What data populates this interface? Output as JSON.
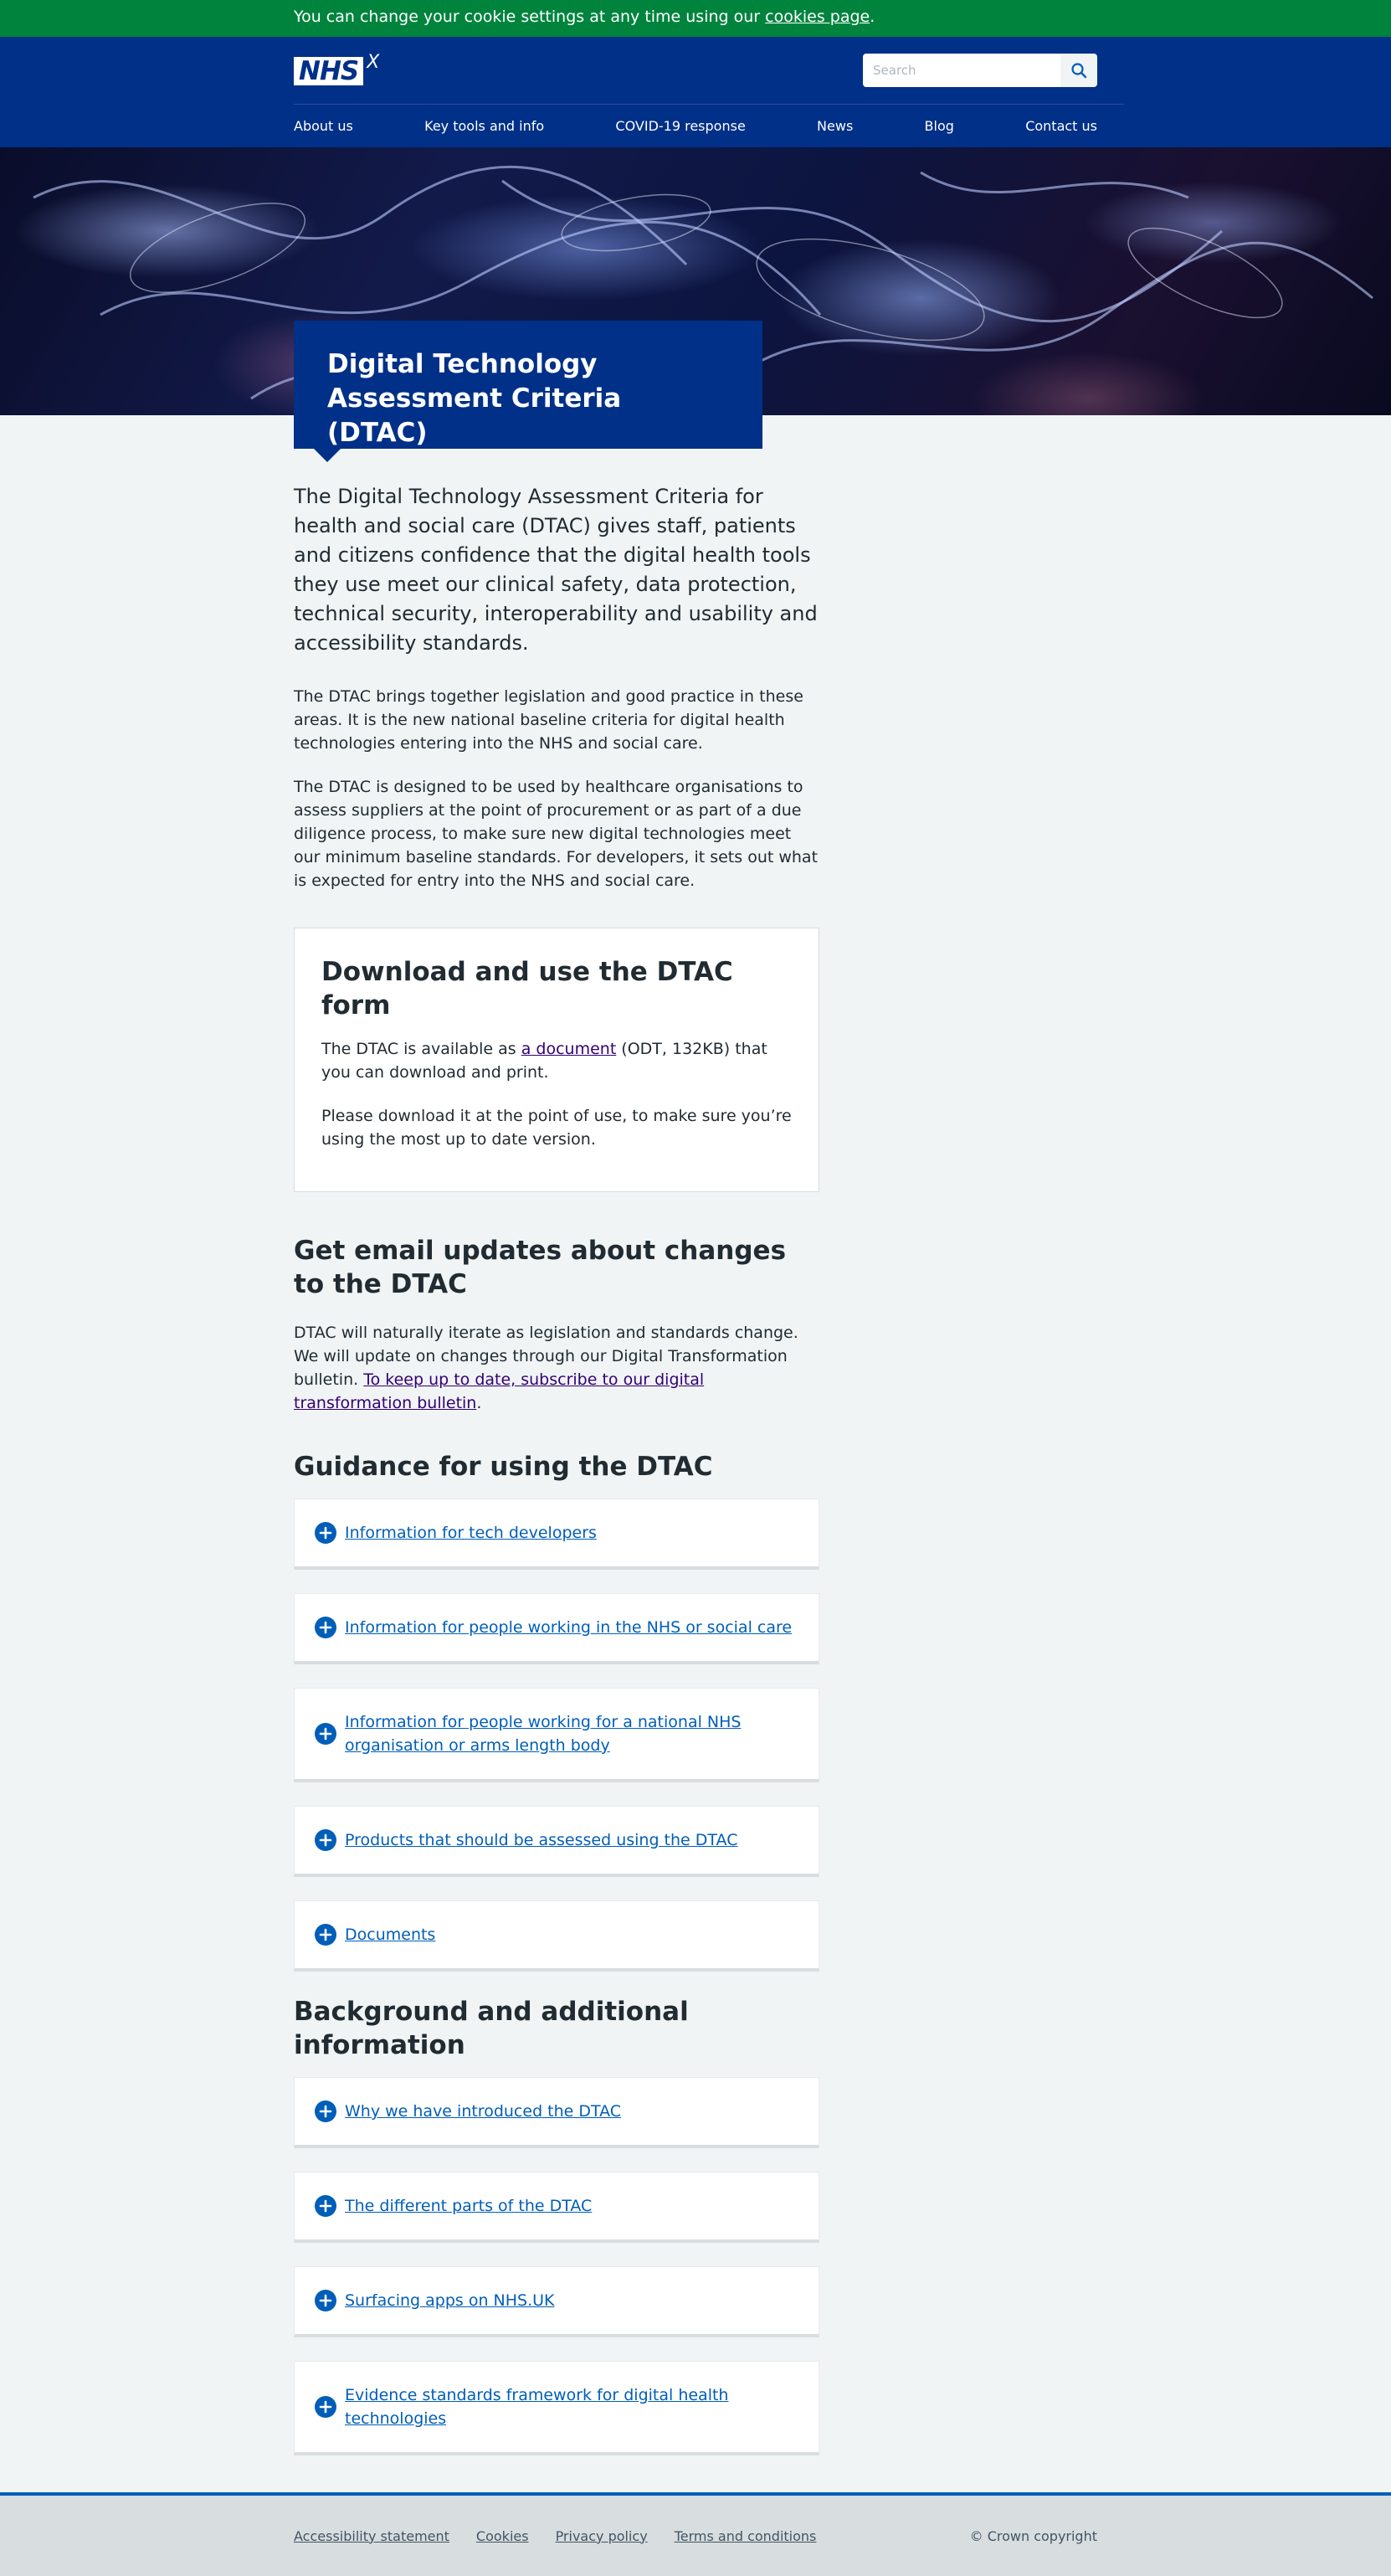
{
  "cookie_banner": {
    "text": "You can change your cookie settings at any time using our",
    "link": "cookies page",
    "suffix": "."
  },
  "header": {
    "logo_text": "NHS",
    "logo_suffix": "X",
    "search_placeholder": "Search",
    "nav": [
      "About us",
      "Key tools and info",
      "COVID-19 response",
      "News",
      "Blog",
      "Contact us"
    ]
  },
  "hero": {
    "title": "Digital Technology Assessment Criteria (DTAC)"
  },
  "intro": {
    "lede": "The Digital Technology Assessment Criteria for health and social care (DTAC) gives staff, patients and citizens confidence that the digital health tools they use meet our clinical safety, data protection, technical security, interoperability and usability and accessibility standards.",
    "para1": "The DTAC brings together legislation and good practice in these areas. It is the new national baseline criteria for digital health technologies entering into the NHS and social care.",
    "para2": "The DTAC is designed to be used by healthcare organisations to assess suppliers at the point of procurement or as part of a due diligence process, to make sure new digital technologies meet our minimum baseline standards. For developers, it sets out what is expected for entry into the NHS and social care."
  },
  "download": {
    "heading": "Download and use the DTAC form",
    "p1_before": "The DTAC is available as ",
    "p1_link": "a document",
    "p1_after": " (ODT, 132KB) that you can download and print.",
    "p2": "Please download it at the point of use, to make sure you’re using the most up to date version."
  },
  "email": {
    "heading": "Get email updates about changes to the DTAC",
    "text": "DTAC will naturally iterate as legislation and standards change. We will update on changes through our Digital Transformation bulletin.",
    "link": "To keep up to date, subscribe to our digital transformation bulletin",
    "suffix": "."
  },
  "guidance": {
    "heading": "Guidance for using the DTAC",
    "items": [
      "Information for tech developers",
      "Information for people working in the NHS or social care",
      "Information for people working for a national NHS organisation or arms length body",
      "Products that should be assessed using the DTAC",
      "Documents"
    ]
  },
  "background": {
    "heading": "Background and additional information",
    "items": [
      "Why we have introduced the DTAC",
      "The different parts of the DTAC",
      "Surfacing apps on NHS.UK",
      "Evidence standards framework for digital health technologies"
    ]
  },
  "footer": {
    "links": [
      "Accessibility statement",
      "Cookies",
      "Privacy policy",
      "Terms and conditions"
    ],
    "copyright": "© Crown copyright"
  },
  "colors": {
    "cookie_banner": "#00843d",
    "header": "#003087",
    "link": "#005eb8",
    "visited_link": "#330072",
    "background": "#f0f4f5"
  }
}
